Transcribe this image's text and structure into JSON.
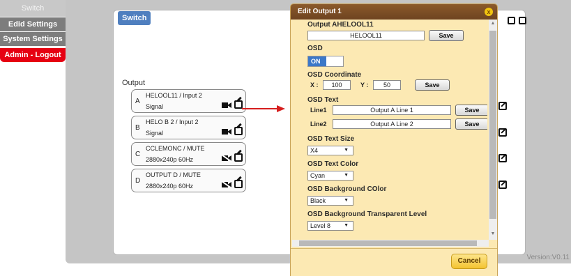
{
  "sidebar": {
    "items": [
      {
        "label": "Switch"
      },
      {
        "label": "Edid Settings"
      },
      {
        "label": "System Settings"
      },
      {
        "label": "Admin - Logout"
      }
    ]
  },
  "main": {
    "tag": "Switch",
    "output_label": "Output",
    "outputs": [
      {
        "letter": "A",
        "top": "HELOOL11  /  Input 2",
        "bottom": "Signal",
        "camera": "camera-icon"
      },
      {
        "letter": "B",
        "top": "HELO B 2   /  Input 2",
        "bottom": "Signal",
        "camera": "camera-icon"
      },
      {
        "letter": "C",
        "top": "CCLEMONC / MUTE",
        "bottom": "2880x240p 60Hz",
        "camera": "camera-off-icon"
      },
      {
        "letter": "D",
        "top": "OUTPUT D / MUTE",
        "bottom": "2880x240p 60Hz",
        "camera": "camera-off-icon"
      }
    ],
    "version": "Version:V0.11"
  },
  "dialog": {
    "title": "Edit Output 1",
    "close": "x",
    "output_name_label": "Output AHELOOL11",
    "output_name_value": "HELOOL11",
    "save": "Save",
    "osd_label": "OSD",
    "osd_value": "ON",
    "coord_label": "OSD Coordinate",
    "x_label": "X :",
    "x_value": "100",
    "y_label": "Y :",
    "y_value": "50",
    "text_label": "OSD Text",
    "line1_label": "Line1",
    "line1_value": "Output A Line 1",
    "line2_label": "Line2",
    "line2_value": "Output A Line 2",
    "size_label": "OSD Text Size",
    "size_value": "X4",
    "color_label": "OSD Text Color",
    "color_value": "Cyan",
    "bg_label": "OSD Background COlor",
    "bg_value": "Black",
    "transparent_label": "OSD Background Transparent Level",
    "transparent_value": "Level 8",
    "cancel": "Cancel"
  },
  "colors": {
    "accent": "#e60012",
    "tag_blue": "#4f7fbf",
    "dialog_bg": "#fce9b3",
    "dialog_title": "#7a4a22"
  }
}
